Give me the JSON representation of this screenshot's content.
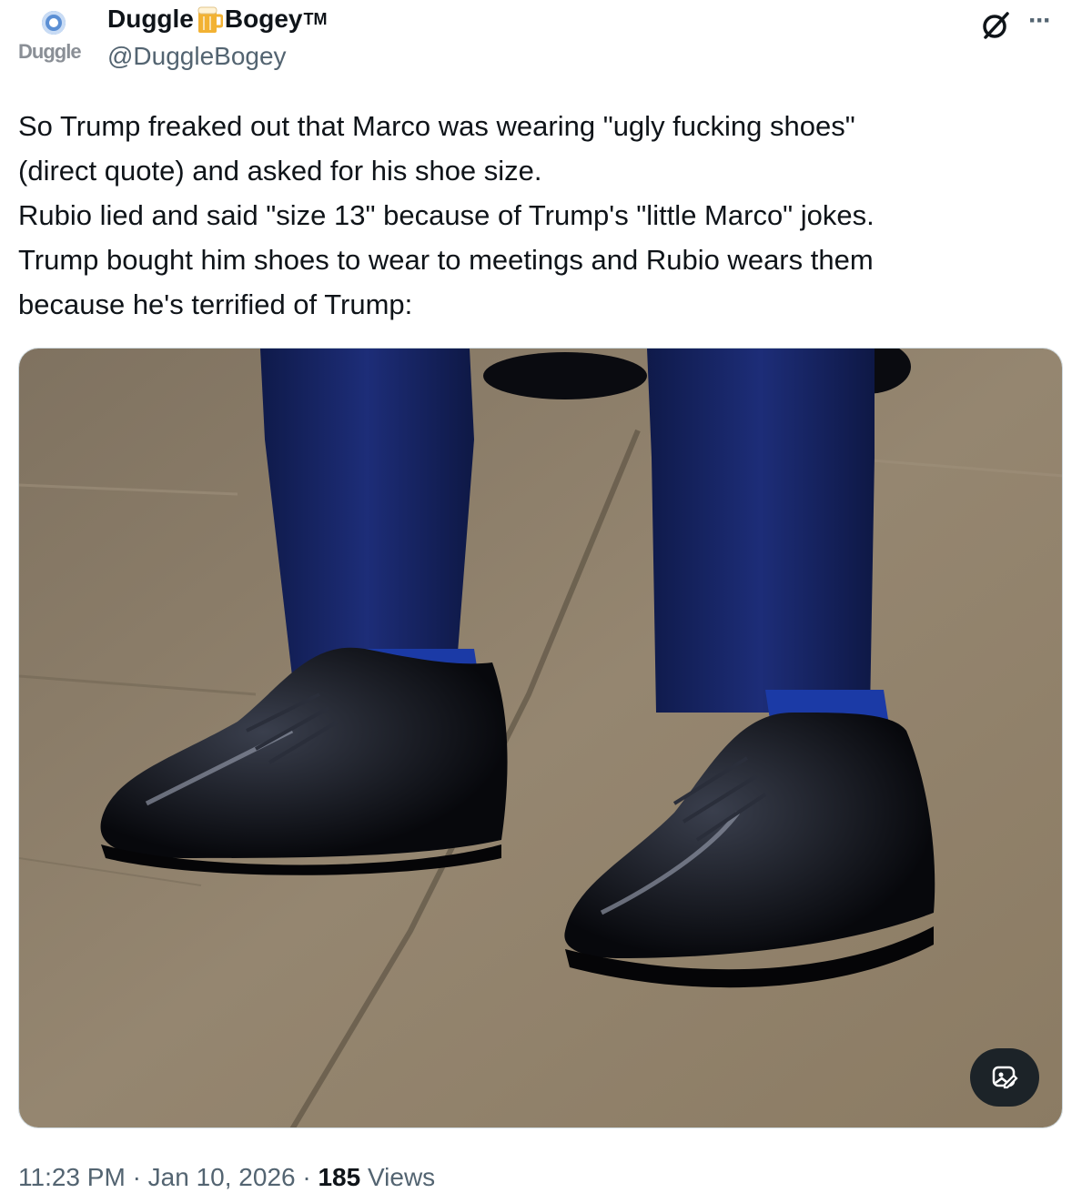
{
  "author": {
    "avatar_text": "Duggle",
    "name_part1": "Duggle",
    "name_part2": "Bogey",
    "trademark": "TM",
    "name_emoji": "beer-mug-icon",
    "handle": "@DuggleBogey"
  },
  "header_icons": [
    "grok-icon",
    "more-options-icon"
  ],
  "text_lines": [
    "So Trump freaked out that Marco was wearing \"ugly fucking shoes\"",
    "(direct quote) and asked for his shoe size.",
    "Rubio lied and said \"size 13\" because of Trump's \"little Marco\" jokes.",
    "Trump bought him shoes to wear to meetings and Rubio wears them",
    "because he's terrified of Trump:"
  ],
  "media": {
    "alt_button_icon": "image-edit-icon"
  },
  "footer": {
    "time": "11:23 PM",
    "separator": "·",
    "date": "Jan 10, 2026",
    "views_count": "185",
    "views_label": "Views"
  },
  "colors": {
    "text": "#0f1419",
    "secondary": "#536471",
    "suit": "#1a2a6e",
    "floor": "#8a7c66"
  }
}
